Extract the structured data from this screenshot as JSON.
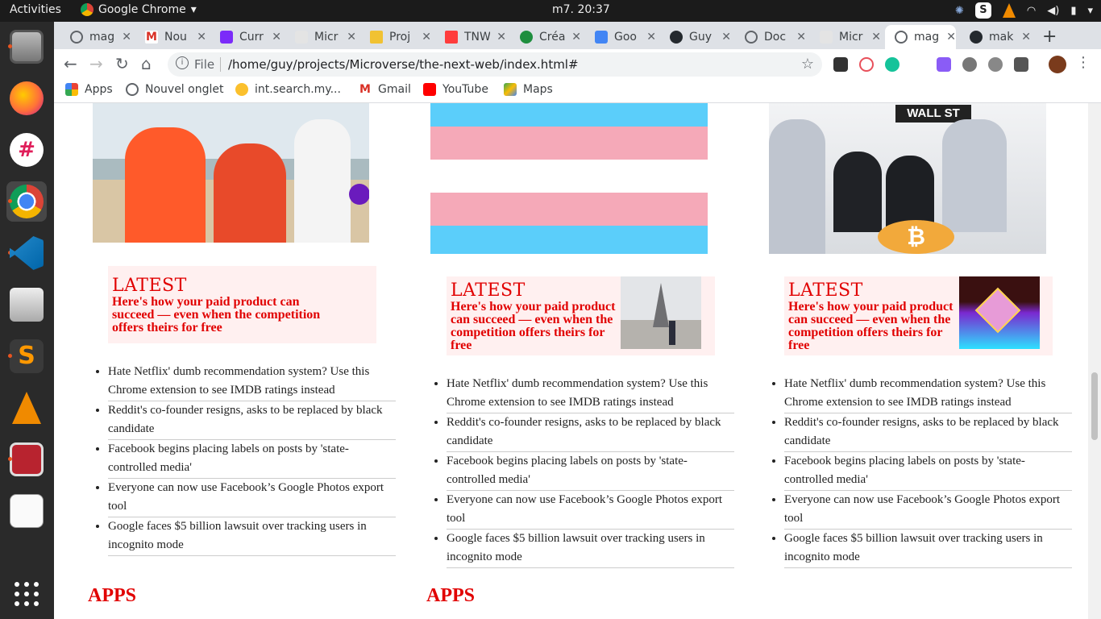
{
  "system": {
    "activities": "Activities",
    "app_name": "Google Chrome",
    "clock": "m7. 20:37"
  },
  "tabs": [
    {
      "label": "mag"
    },
    {
      "label": "Nou"
    },
    {
      "label": "Curr"
    },
    {
      "label": "Micr"
    },
    {
      "label": "Proj"
    },
    {
      "label": "TNW"
    },
    {
      "label": "Créa"
    },
    {
      "label": "Goo"
    },
    {
      "label": "Guy"
    },
    {
      "label": "Doc"
    },
    {
      "label": "Micr"
    },
    {
      "label": "mag"
    },
    {
      "label": "mak"
    }
  ],
  "toolbar": {
    "scheme": "File",
    "url": "/home/guy/projects/Microverse/the-next-web/index.html#"
  },
  "bookmarks": [
    {
      "label": "Apps"
    },
    {
      "label": "Nouvel onglet"
    },
    {
      "label": "int.search.my..."
    },
    {
      "label": "Gmail"
    },
    {
      "label": "YouTube"
    },
    {
      "label": "Maps"
    }
  ],
  "columns": [
    {
      "latest_label": "LATEST",
      "headline": "Here's how your paid product can succeed — even when the competition offers theirs for free",
      "news": [
        "Hate Netflix' dumb recommendation system? Use this Chrome extension to see IMDB ratings instead",
        "Reddit's co-founder resigns, asks to be replaced by black candidate",
        "Facebook begins placing labels on posts by 'state-controlled media'",
        "Everyone can now use Facebook’s Google Photos export tool",
        "Google faces $5 billion lawsuit over tracking users in incognito mode"
      ],
      "section": "APPS"
    },
    {
      "latest_label": "LATEST",
      "headline": "Here's how your paid product can succeed — even when the competition offers theirs for free",
      "news": [
        "Hate Netflix' dumb recommendation system? Use this Chrome extension to see IMDB ratings instead",
        "Reddit's co-founder resigns, asks to be replaced by black candidate",
        "Facebook begins placing labels on posts by 'state-controlled media'",
        "Everyone can now use Facebook’s Google Photos export tool",
        "Google faces $5 billion lawsuit over tracking users in incognito mode"
      ],
      "section": "APPS"
    },
    {
      "latest_label": "LATEST",
      "headline": "Here's how your paid product can succeed — even when the competition offers theirs for free",
      "news": [
        "Hate Netflix' dumb recommendation system? Use this Chrome extension to see IMDB ratings instead",
        "Reddit's co-founder resigns, asks to be replaced by black candidate",
        "Facebook begins placing labels on posts by 'state-controlled media'",
        "Everyone can now use Facebook’s Google Photos export tool",
        "Google faces $5 billion lawsuit over tracking users in incognito mode"
      ]
    }
  ],
  "photo_signs": {
    "wall_street": "WALL ST"
  },
  "colors": {
    "accent_red": "#e10000",
    "card_bg": "#fff0f0",
    "flag_blue": "#5bcefa",
    "flag_pink": "#f5a9b8"
  }
}
